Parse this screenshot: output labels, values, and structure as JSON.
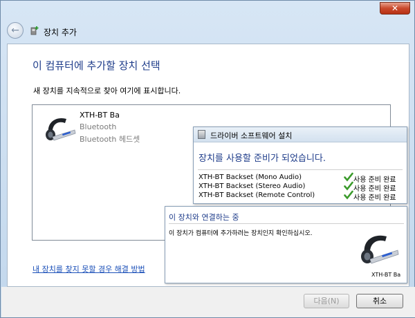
{
  "window": {
    "title": "장치 추가",
    "close_label": "✕"
  },
  "main": {
    "heading": "이 컴퓨터에 추가할 장치 선택",
    "subtitle": "새 장치를 지속적으로 찾아 여기에 표시합니다.",
    "devices": [
      {
        "name": "XTH-BT Ba",
        "type": "Bluetooth",
        "subtype": "Bluetooth 헤드셋"
      }
    ],
    "help_link": "내 장치를 찾지 못할 경우 해결 방법"
  },
  "footer": {
    "next_label": "다음(N)",
    "cancel_label": "취소"
  },
  "driver_popup": {
    "title": "드라이버 소프트웨어 설치",
    "heading": "장치를 사용할 준비가 되었습니다.",
    "rows": [
      {
        "name": "XTH-BT Backset (Mono Audio)",
        "status": "사용 준비 완료"
      },
      {
        "name": "XTH-BT Backset (Stereo Audio)",
        "status": "사용 준비 완료"
      },
      {
        "name": "XTH-BT Backset (Remote Control)",
        "status": "사용 준비 완료"
      }
    ]
  },
  "connect_popup": {
    "heading": "이 장치와 연결하는 중",
    "text": "이 장치가 컴퓨터에 추가하려는 장치인지 확인하십시오.",
    "device_name": "XTH-BT Ba"
  },
  "colors": {
    "heading_blue": "#1e3c8a",
    "link_blue": "#1a4fb8",
    "check_green": "#3a9a2a"
  },
  "icons": {
    "back": "back-arrow-icon",
    "title": "add-device-icon",
    "headset": "bluetooth-headset-icon",
    "check": "checkmark-icon",
    "driver": "driver-install-icon"
  }
}
